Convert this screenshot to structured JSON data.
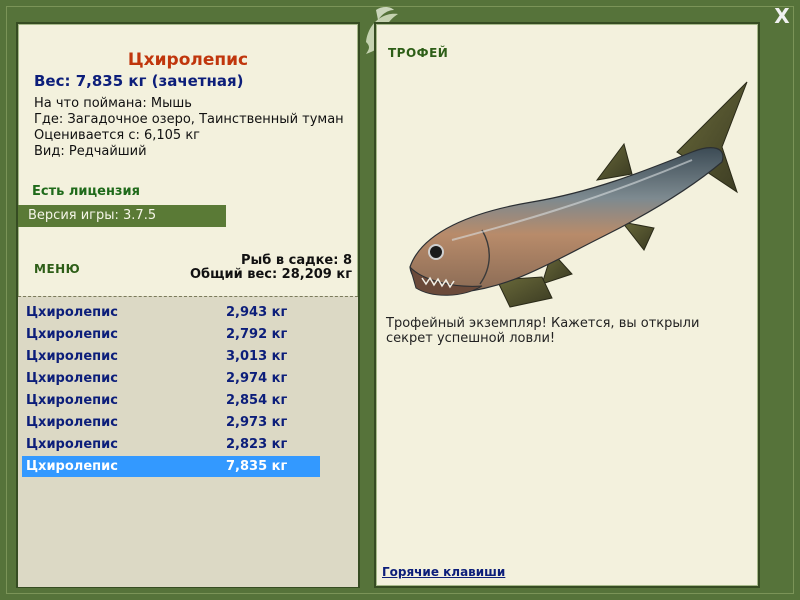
{
  "fish": {
    "title": "Цхиролепис",
    "weight_line": "Вес: 7,835 кг (зачетная)",
    "caught_on": "На что поймана: Мышь",
    "location": "Где: Загадочное озеро, Таинственный туман",
    "rated_from": "Оценивается с: 6,105 кг",
    "rarity": "Вид: Редчайший"
  },
  "license": "Есть лицензия",
  "version": "Версия игры: 3.7.5",
  "menu_label": "МЕНЮ",
  "cage": {
    "count": "Рыб в садке: 8",
    "total_weight": "Общий вес: 28,209 кг"
  },
  "catch_list": [
    {
      "name": "Цхиролепис",
      "weight": "2,943 кг"
    },
    {
      "name": "Цхиролепис",
      "weight": "2,792 кг"
    },
    {
      "name": "Цхиролепис",
      "weight": "3,013 кг"
    },
    {
      "name": "Цхиролепис",
      "weight": "2,974 кг"
    },
    {
      "name": "Цхиролепис",
      "weight": "2,854 кг"
    },
    {
      "name": "Цхиролепис",
      "weight": "2,973 кг"
    },
    {
      "name": "Цхиролепис",
      "weight": "2,823 кг"
    },
    {
      "name": "Цхиролепис",
      "weight": "7,835 кг"
    }
  ],
  "selected_index": 7,
  "trophy": {
    "label": "ТРОФЕЙ",
    "description": "Трофейный экземпляр! Кажется, вы открыли секрет успешной ловли!"
  },
  "hotkeys_link": "Горячие клавиши",
  "close_label": "X",
  "colors": {
    "frame": "#56733a",
    "panel": "#f3f1dd",
    "selection": "#3399ff",
    "title_red": "#c0360c",
    "link_blue": "#0c1e7a"
  }
}
